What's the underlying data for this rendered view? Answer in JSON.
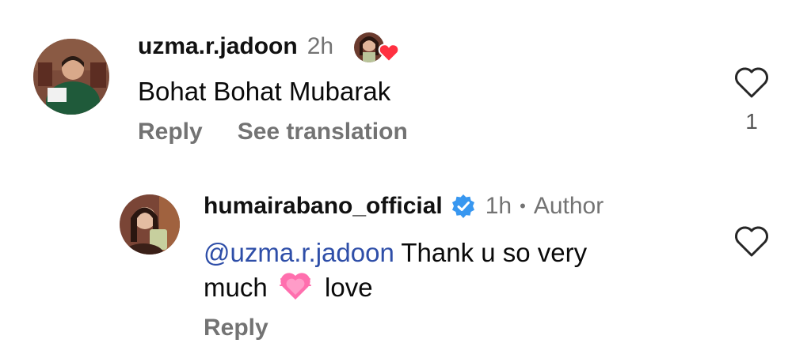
{
  "comments": [
    {
      "username": "uzma.r.jadoon",
      "time": "2h",
      "text": "Bohat Bohat Mubarak",
      "reply_label": "Reply",
      "translate_label": "See translation",
      "like_count": "1",
      "avatar_icon": "user-avatar",
      "reaction_icon": "author-liked-heart-icon"
    }
  ],
  "reply": {
    "username": "humairabano_official",
    "verified_icon": "verified-badge-icon",
    "time": "1h",
    "separator": "•",
    "author_label": "Author",
    "mention": "@uzma.r.jadoon",
    "text_part1": " Thank u so very",
    "text_part2": "much",
    "emoji": "pink-heart-emoji",
    "text_part3": "love",
    "reply_label": "Reply"
  },
  "colors": {
    "mention": "#2e4ea8",
    "verified": "#3897f0",
    "muted": "#737373",
    "reaction_heart": "#ff3040"
  }
}
